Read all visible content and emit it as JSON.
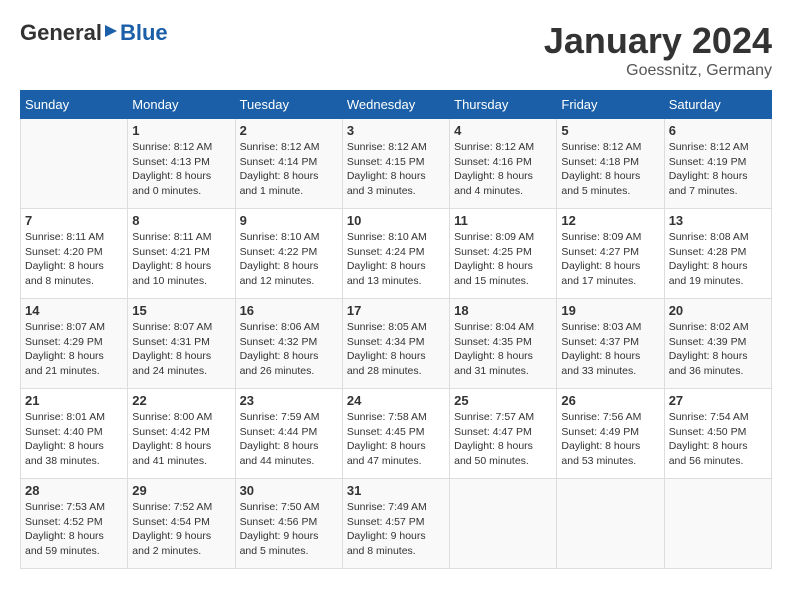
{
  "header": {
    "logo_general": "General",
    "logo_blue": "Blue",
    "month_title": "January 2024",
    "location": "Goessnitz, Germany"
  },
  "weekdays": [
    "Sunday",
    "Monday",
    "Tuesday",
    "Wednesday",
    "Thursday",
    "Friday",
    "Saturday"
  ],
  "weeks": [
    [
      {
        "day": "",
        "info": ""
      },
      {
        "day": "1",
        "info": "Sunrise: 8:12 AM\nSunset: 4:13 PM\nDaylight: 8 hours\nand 0 minutes."
      },
      {
        "day": "2",
        "info": "Sunrise: 8:12 AM\nSunset: 4:14 PM\nDaylight: 8 hours\nand 1 minute."
      },
      {
        "day": "3",
        "info": "Sunrise: 8:12 AM\nSunset: 4:15 PM\nDaylight: 8 hours\nand 3 minutes."
      },
      {
        "day": "4",
        "info": "Sunrise: 8:12 AM\nSunset: 4:16 PM\nDaylight: 8 hours\nand 4 minutes."
      },
      {
        "day": "5",
        "info": "Sunrise: 8:12 AM\nSunset: 4:18 PM\nDaylight: 8 hours\nand 5 minutes."
      },
      {
        "day": "6",
        "info": "Sunrise: 8:12 AM\nSunset: 4:19 PM\nDaylight: 8 hours\nand 7 minutes."
      }
    ],
    [
      {
        "day": "7",
        "info": "Sunrise: 8:11 AM\nSunset: 4:20 PM\nDaylight: 8 hours\nand 8 minutes."
      },
      {
        "day": "8",
        "info": "Sunrise: 8:11 AM\nSunset: 4:21 PM\nDaylight: 8 hours\nand 10 minutes."
      },
      {
        "day": "9",
        "info": "Sunrise: 8:10 AM\nSunset: 4:22 PM\nDaylight: 8 hours\nand 12 minutes."
      },
      {
        "day": "10",
        "info": "Sunrise: 8:10 AM\nSunset: 4:24 PM\nDaylight: 8 hours\nand 13 minutes."
      },
      {
        "day": "11",
        "info": "Sunrise: 8:09 AM\nSunset: 4:25 PM\nDaylight: 8 hours\nand 15 minutes."
      },
      {
        "day": "12",
        "info": "Sunrise: 8:09 AM\nSunset: 4:27 PM\nDaylight: 8 hours\nand 17 minutes."
      },
      {
        "day": "13",
        "info": "Sunrise: 8:08 AM\nSunset: 4:28 PM\nDaylight: 8 hours\nand 19 minutes."
      }
    ],
    [
      {
        "day": "14",
        "info": "Sunrise: 8:07 AM\nSunset: 4:29 PM\nDaylight: 8 hours\nand 21 minutes."
      },
      {
        "day": "15",
        "info": "Sunrise: 8:07 AM\nSunset: 4:31 PM\nDaylight: 8 hours\nand 24 minutes."
      },
      {
        "day": "16",
        "info": "Sunrise: 8:06 AM\nSunset: 4:32 PM\nDaylight: 8 hours\nand 26 minutes."
      },
      {
        "day": "17",
        "info": "Sunrise: 8:05 AM\nSunset: 4:34 PM\nDaylight: 8 hours\nand 28 minutes."
      },
      {
        "day": "18",
        "info": "Sunrise: 8:04 AM\nSunset: 4:35 PM\nDaylight: 8 hours\nand 31 minutes."
      },
      {
        "day": "19",
        "info": "Sunrise: 8:03 AM\nSunset: 4:37 PM\nDaylight: 8 hours\nand 33 minutes."
      },
      {
        "day": "20",
        "info": "Sunrise: 8:02 AM\nSunset: 4:39 PM\nDaylight: 8 hours\nand 36 minutes."
      }
    ],
    [
      {
        "day": "21",
        "info": "Sunrise: 8:01 AM\nSunset: 4:40 PM\nDaylight: 8 hours\nand 38 minutes."
      },
      {
        "day": "22",
        "info": "Sunrise: 8:00 AM\nSunset: 4:42 PM\nDaylight: 8 hours\nand 41 minutes."
      },
      {
        "day": "23",
        "info": "Sunrise: 7:59 AM\nSunset: 4:44 PM\nDaylight: 8 hours\nand 44 minutes."
      },
      {
        "day": "24",
        "info": "Sunrise: 7:58 AM\nSunset: 4:45 PM\nDaylight: 8 hours\nand 47 minutes."
      },
      {
        "day": "25",
        "info": "Sunrise: 7:57 AM\nSunset: 4:47 PM\nDaylight: 8 hours\nand 50 minutes."
      },
      {
        "day": "26",
        "info": "Sunrise: 7:56 AM\nSunset: 4:49 PM\nDaylight: 8 hours\nand 53 minutes."
      },
      {
        "day": "27",
        "info": "Sunrise: 7:54 AM\nSunset: 4:50 PM\nDaylight: 8 hours\nand 56 minutes."
      }
    ],
    [
      {
        "day": "28",
        "info": "Sunrise: 7:53 AM\nSunset: 4:52 PM\nDaylight: 8 hours\nand 59 minutes."
      },
      {
        "day": "29",
        "info": "Sunrise: 7:52 AM\nSunset: 4:54 PM\nDaylight: 9 hours\nand 2 minutes."
      },
      {
        "day": "30",
        "info": "Sunrise: 7:50 AM\nSunset: 4:56 PM\nDaylight: 9 hours\nand 5 minutes."
      },
      {
        "day": "31",
        "info": "Sunrise: 7:49 AM\nSunset: 4:57 PM\nDaylight: 9 hours\nand 8 minutes."
      },
      {
        "day": "",
        "info": ""
      },
      {
        "day": "",
        "info": ""
      },
      {
        "day": "",
        "info": ""
      }
    ]
  ]
}
